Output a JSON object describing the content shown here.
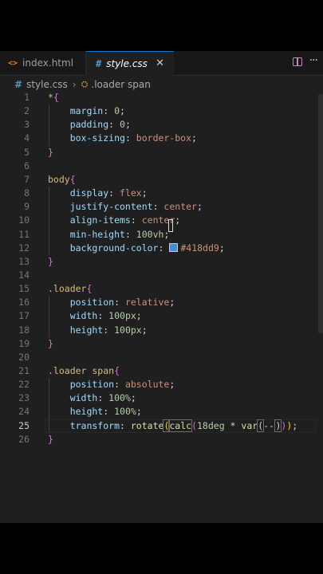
{
  "tabs": [
    {
      "icon": "<>",
      "label": "index.html",
      "active": false
    },
    {
      "icon": "#",
      "label": "style.css",
      "active": true,
      "close": "✕"
    }
  ],
  "breadcrumb": {
    "file": "style.css",
    "symbol": ".loader span"
  },
  "editor": {
    "current_line": 25
  },
  "code_lines": [
    {
      "n": "1",
      "tokens": [
        [
          "t-sel",
          "*"
        ],
        [
          "t-brace",
          "{"
        ]
      ]
    },
    {
      "n": "2",
      "tokens": [
        [
          "t-prop",
          "    margin"
        ],
        [
          "t-punc",
          ": "
        ],
        [
          "t-num",
          "0"
        ],
        [
          "t-punc",
          ";"
        ]
      ]
    },
    {
      "n": "3",
      "tokens": [
        [
          "t-prop",
          "    padding"
        ],
        [
          "t-punc",
          ": "
        ],
        [
          "t-num",
          "0"
        ],
        [
          "t-punc",
          ";"
        ]
      ]
    },
    {
      "n": "4",
      "tokens": [
        [
          "t-prop",
          "    box-sizing"
        ],
        [
          "t-punc",
          ": "
        ],
        [
          "t-val",
          "border-box"
        ],
        [
          "t-punc",
          ";"
        ]
      ]
    },
    {
      "n": "5",
      "tokens": [
        [
          "t-brace",
          "}"
        ]
      ]
    },
    {
      "n": "6",
      "tokens": []
    },
    {
      "n": "7",
      "tokens": [
        [
          "t-sel",
          "body"
        ],
        [
          "t-brace",
          "{"
        ]
      ]
    },
    {
      "n": "8",
      "tokens": [
        [
          "t-prop",
          "    display"
        ],
        [
          "t-punc",
          ": "
        ],
        [
          "t-val",
          "flex"
        ],
        [
          "t-punc",
          ";"
        ]
      ]
    },
    {
      "n": "9",
      "tokens": [
        [
          "t-prop",
          "    justify-content"
        ],
        [
          "t-punc",
          ": "
        ],
        [
          "t-val",
          "center"
        ],
        [
          "t-punc",
          ";"
        ]
      ]
    },
    {
      "n": "10",
      "tokens": [
        [
          "t-prop",
          "    align-items"
        ],
        [
          "t-punc",
          ": "
        ],
        [
          "t-val",
          "center"
        ],
        [
          "t-punc",
          ";"
        ]
      ]
    },
    {
      "n": "11",
      "tokens": [
        [
          "t-prop",
          "    min-height"
        ],
        [
          "t-punc",
          ": "
        ],
        [
          "t-num",
          "100vh"
        ],
        [
          "t-punc",
          ";"
        ]
      ]
    },
    {
      "n": "12",
      "tokens": [
        [
          "t-prop",
          "    background-color"
        ],
        [
          "t-punc",
          ": "
        ],
        [
          "swatch",
          "#418dd9"
        ],
        [
          "t-val",
          "#418dd9"
        ],
        [
          "t-punc",
          ";"
        ]
      ]
    },
    {
      "n": "13",
      "tokens": [
        [
          "t-brace",
          "}"
        ]
      ]
    },
    {
      "n": "14",
      "tokens": []
    },
    {
      "n": "15",
      "tokens": [
        [
          "t-sel",
          ".loader"
        ],
        [
          "t-brace",
          "{"
        ]
      ]
    },
    {
      "n": "16",
      "tokens": [
        [
          "t-prop",
          "    position"
        ],
        [
          "t-punc",
          ": "
        ],
        [
          "t-val",
          "relative"
        ],
        [
          "t-punc",
          ";"
        ]
      ]
    },
    {
      "n": "17",
      "tokens": [
        [
          "t-prop",
          "    width"
        ],
        [
          "t-punc",
          ": "
        ],
        [
          "t-num",
          "100px"
        ],
        [
          "t-punc",
          ";"
        ]
      ]
    },
    {
      "n": "18",
      "tokens": [
        [
          "t-prop",
          "    height"
        ],
        [
          "t-punc",
          ": "
        ],
        [
          "t-num",
          "100px"
        ],
        [
          "t-punc",
          ";"
        ]
      ]
    },
    {
      "n": "19",
      "tokens": [
        [
          "t-brace",
          "}"
        ]
      ]
    },
    {
      "n": "20",
      "tokens": []
    },
    {
      "n": "21",
      "tokens": [
        [
          "t-sel",
          ".loader span"
        ],
        [
          "t-brace",
          "{"
        ]
      ]
    },
    {
      "n": "22",
      "tokens": [
        [
          "t-prop",
          "    position"
        ],
        [
          "t-punc",
          ": "
        ],
        [
          "t-val",
          "absolute"
        ],
        [
          "t-punc",
          ";"
        ]
      ]
    },
    {
      "n": "23",
      "tokens": [
        [
          "t-prop",
          "    width"
        ],
        [
          "t-punc",
          ": "
        ],
        [
          "t-num",
          "100%"
        ],
        [
          "t-punc",
          ";"
        ]
      ]
    },
    {
      "n": "24",
      "tokens": [
        [
          "t-prop",
          "    height"
        ],
        [
          "t-punc",
          ": "
        ],
        [
          "t-num",
          "100%"
        ],
        [
          "t-punc",
          ";"
        ]
      ]
    },
    {
      "n": "25",
      "tokens": [
        [
          "t-prop",
          "    transform"
        ],
        [
          "t-punc",
          ": "
        ],
        [
          "t-fn",
          "rotate"
        ],
        [
          "t-brace2 bm",
          "("
        ],
        [
          "t-fn bm",
          "calc"
        ],
        [
          "t-brace",
          "("
        ],
        [
          "t-num",
          "18deg"
        ],
        [
          "t-punc",
          " * "
        ],
        [
          "t-fn",
          "var"
        ],
        [
          "t-punc bm",
          "("
        ],
        [
          "t-prop",
          "--"
        ],
        [
          "caret",
          ""
        ],
        [
          "t-punc bm",
          ")"
        ],
        [
          "t-brace",
          ")"
        ],
        [
          "t-brace2",
          ")"
        ],
        [
          "t-punc",
          ";"
        ]
      ]
    },
    {
      "n": "26",
      "tokens": [
        [
          "t-brace",
          "}"
        ]
      ]
    }
  ]
}
